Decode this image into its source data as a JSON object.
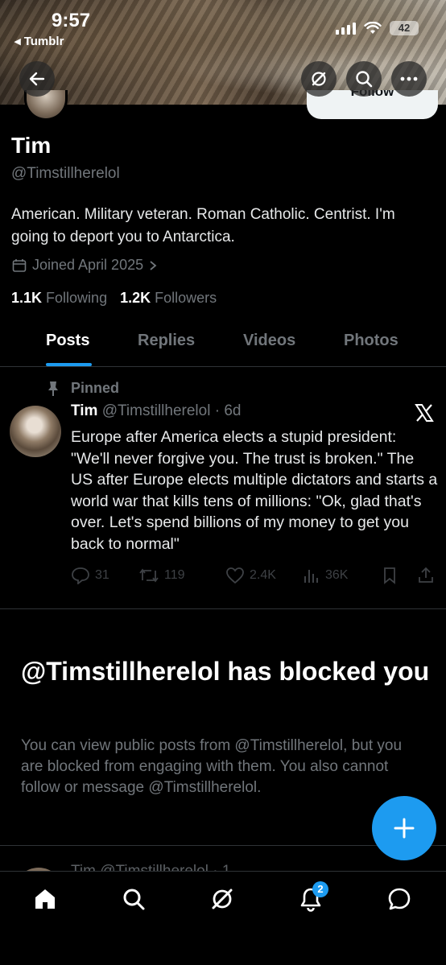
{
  "status_bar": {
    "time": "9:57",
    "back_app": "Tumblr",
    "battery": "42"
  },
  "profile": {
    "follow_label": "Follow",
    "name": "Tim",
    "handle": "@Timstillherelol",
    "bio": "American. Military veteran. Roman Catholic. Centrist. I'm going to deport you to Antarctica.",
    "joined": "Joined April 2025",
    "following_count": "1.1K",
    "following_label": "Following",
    "followers_count": "1.2K",
    "followers_label": "Followers"
  },
  "tabs": [
    {
      "label": "Posts",
      "active": true
    },
    {
      "label": "Replies",
      "active": false
    },
    {
      "label": "Videos",
      "active": false
    },
    {
      "label": "Photos",
      "active": false
    }
  ],
  "pinned_tweet": {
    "pinned_label": "Pinned",
    "author": "Tim",
    "handle_time": "@Timstillherelol · 6d",
    "text": "Europe after America elects a stupid president: \"We'll never forgive you. The trust is broken.\" The US after Europe elects multiple dictators and starts a world war that kills tens of millions: \"Ok, glad that's over. Let's spend billions of my money to get you back to normal\"",
    "replies": "31",
    "reposts": "119",
    "likes": "2.4K",
    "views": "36K"
  },
  "blocked": {
    "title": "@Timstillherelol has blocked you",
    "text": "You can view public posts from @Timstillherelol, but you are blocked from engaging with them. You also cannot follow or message @Timstillherelol."
  },
  "peek_tweet": {
    "text": "Tim @Timstillherelol · 1"
  },
  "nav": {
    "notifications_badge": "2"
  },
  "colors": {
    "accent": "#1d9bf0",
    "background": "#000000",
    "muted": "#71767b"
  }
}
